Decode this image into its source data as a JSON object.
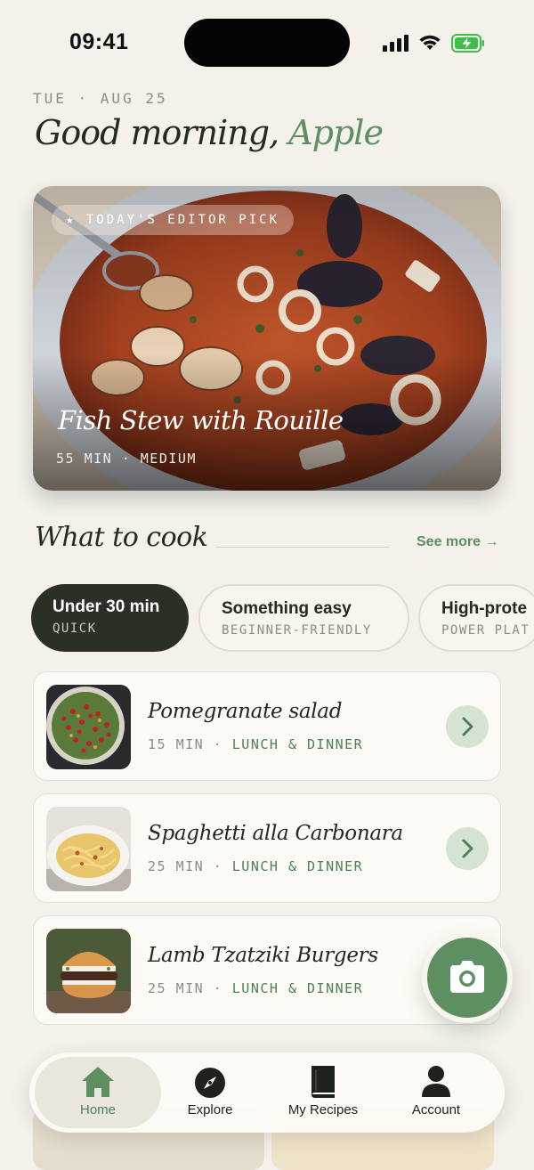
{
  "status_bar": {
    "time": "09:41"
  },
  "header": {
    "date": "TUE · AUG 25",
    "greeting": "Good morning,",
    "name": "Apple"
  },
  "hero": {
    "badge": "★ TODAY'S EDITOR PICK",
    "title": "Fish Stew with Rouille",
    "meta": "55 MIN · MEDIUM"
  },
  "section": {
    "title": "What to cook",
    "see_more": "See more →"
  },
  "chips": [
    {
      "title": "Under 30 min",
      "subtitle": "QUICK",
      "active": true
    },
    {
      "title": "Something easy",
      "subtitle": "BEGINNER-FRIENDLY",
      "active": false
    },
    {
      "title": "High-prote",
      "subtitle": "POWER PLAT",
      "active": false
    }
  ],
  "recipes": [
    {
      "title": "Pomegranate salad",
      "time": "15 MIN",
      "category": "LUNCH & DINNER"
    },
    {
      "title": "Spaghetti alla Carbonara",
      "time": "25 MIN",
      "category": "LUNCH & DINNER"
    },
    {
      "title": "Lamb Tzatziki Burgers",
      "time": "25 MIN",
      "category": "LUNCH & DINNER"
    }
  ],
  "separator": "·",
  "tabbar": {
    "tabs": [
      {
        "label": "Home",
        "icon": "home-icon",
        "active": true
      },
      {
        "label": "Explore",
        "icon": "compass-icon",
        "active": false
      },
      {
        "label": "My Recipes",
        "icon": "book-icon",
        "active": false
      },
      {
        "label": "Account",
        "icon": "person-icon",
        "active": false
      }
    ]
  },
  "colors": {
    "background": "#f3f1ea",
    "accent": "#5d8f63",
    "dark_chip": "#2b3026",
    "arrow_bg": "#d5e3d2"
  }
}
